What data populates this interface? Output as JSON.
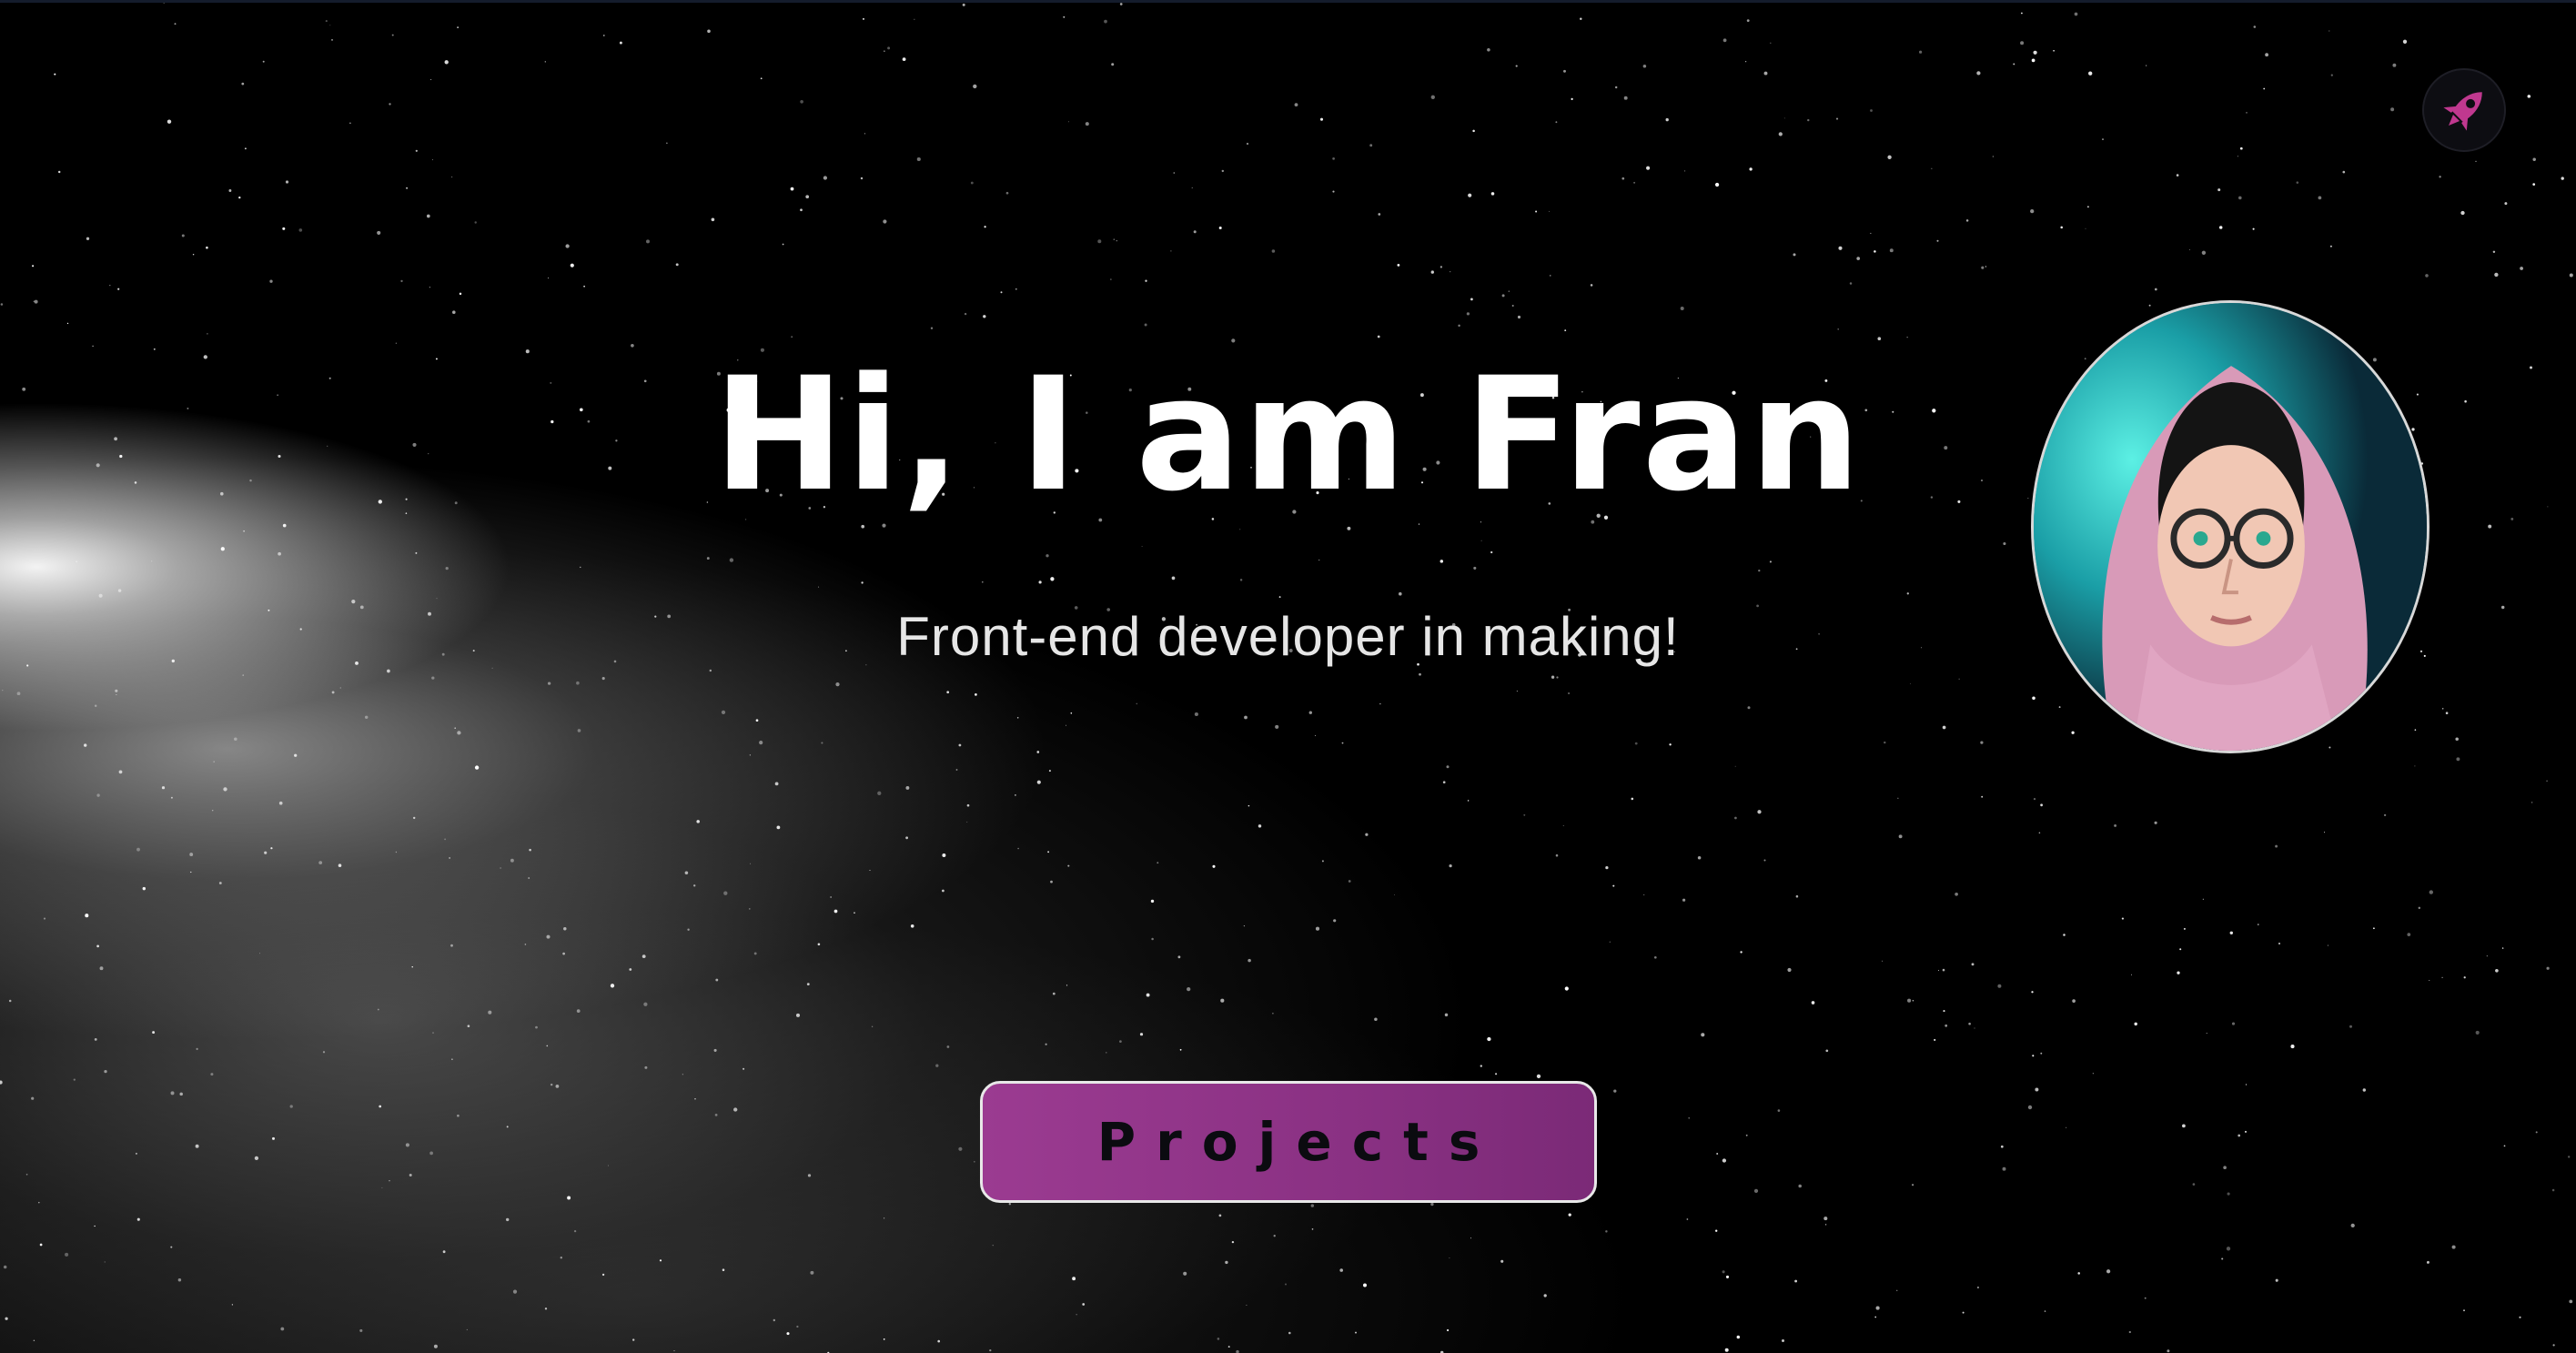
{
  "hero": {
    "title": "Hi, I am Fran",
    "subtitle": "Front-end developer in making!"
  },
  "nav": {
    "rocket_icon": "rocket-icon"
  },
  "avatar": {
    "icon": "portrait-avatar"
  },
  "cta": {
    "projects_label": "Projects"
  },
  "colors": {
    "background": "#000000",
    "accent": "#9b3b91",
    "rocket": "#c0388f",
    "title_text": "#ffffff"
  }
}
